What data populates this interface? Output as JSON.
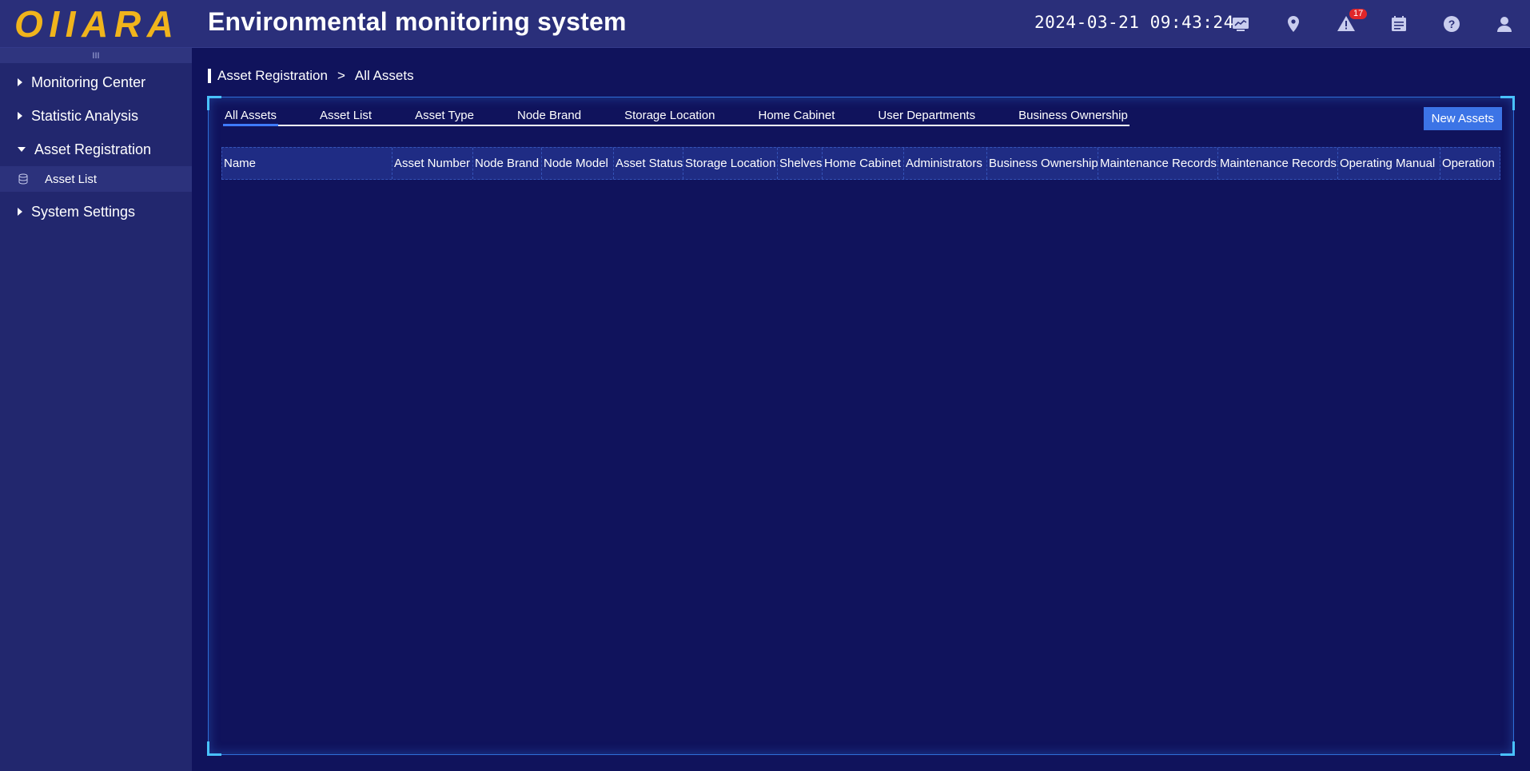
{
  "header": {
    "logo_text": "OIIARA",
    "title": "Environmental monitoring system",
    "datetime": "2024-03-21 09:43:24",
    "alert_count": "17",
    "icons": [
      "monitor-icon",
      "location-pin-icon",
      "alert-icon",
      "calendar-icon",
      "help-icon",
      "user-icon"
    ]
  },
  "sidebar": {
    "collapse_glyph": "III",
    "items": [
      {
        "label": "Monitoring Center",
        "expanded": false
      },
      {
        "label": "Statistic Analysis",
        "expanded": false
      },
      {
        "label": "Asset Registration",
        "expanded": true,
        "children": [
          {
            "label": "Asset List"
          }
        ]
      },
      {
        "label": "System Settings",
        "expanded": false
      }
    ]
  },
  "breadcrumb": {
    "parent": "Asset Registration",
    "separator": ">",
    "current": "All Assets"
  },
  "tabs": [
    {
      "label": "All Assets",
      "active": true
    },
    {
      "label": "Asset List"
    },
    {
      "label": "Asset Type"
    },
    {
      "label": "Node Brand"
    },
    {
      "label": "Storage Location"
    },
    {
      "label": "Home Cabinet"
    },
    {
      "label": "User Departments"
    },
    {
      "label": "Business Ownership"
    }
  ],
  "new_button_label": "New Assets",
  "table": {
    "columns": [
      "Name",
      "Asset Number",
      "Node Brand",
      "Node Model",
      "Asset Status",
      "Storage Location",
      "Shelves",
      "Home Cabinet",
      "Administrators",
      "Business Ownership",
      "Maintenance Records",
      "Maintenance Records",
      "Operating Manual",
      "Operation"
    ],
    "rows": []
  },
  "colors": {
    "background": "#10135c",
    "header": "#2a2f7a",
    "sidebar": "#22276e",
    "logo": "#f0b41c",
    "accent_button": "#3c74e6",
    "panel_border": "#2e6fd8",
    "badge": "#e0262a"
  }
}
